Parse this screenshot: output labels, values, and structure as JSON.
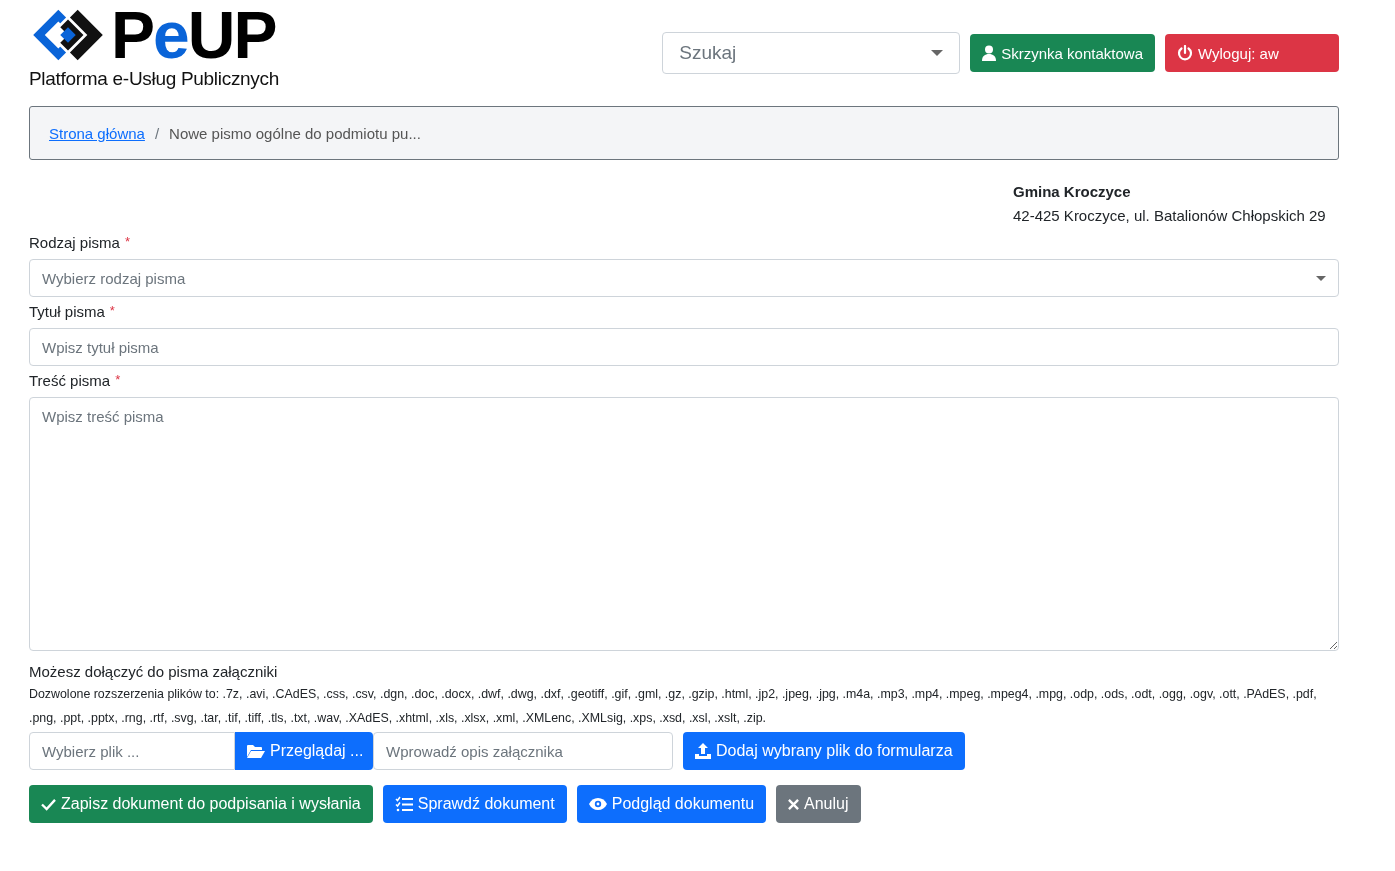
{
  "logo": {
    "parts": [
      {
        "text": "P",
        "accent": false
      },
      {
        "text": "e",
        "accent": true
      },
      {
        "text": "UP",
        "accent": false
      }
    ],
    "subtitle": "Platforma e-Usług Publicznych"
  },
  "search": {
    "placeholder": "Szukaj"
  },
  "header_buttons": [
    {
      "kind": "contact",
      "label": "Skrzynka kontaktowa"
    },
    {
      "kind": "logout",
      "label": "Wyloguj: aw"
    }
  ],
  "breadcrumb_separator": "/",
  "breadcrumb": [
    {
      "label": "Strona główna",
      "link": true
    },
    {
      "label": "Nowe pismo ogólne do podmiotu pu...",
      "link": false
    }
  ],
  "recipient": {
    "name": "Gmina Kroczyce",
    "address": "42-425 Kroczyce, ul. Batalionów Chłopskich 29"
  },
  "fields": [
    {
      "kind": "select",
      "label": "Rodzaj pisma",
      "required_mark": "*",
      "placeholder": "Wybierz rodzaj pisma"
    },
    {
      "kind": "text",
      "label": "Tytuł pisma",
      "required_mark": "*",
      "placeholder": "Wpisz tytuł pisma"
    },
    {
      "kind": "textarea",
      "label": "Treść pisma",
      "required_mark": "*",
      "placeholder": "Wpisz treść pisma"
    }
  ],
  "attachments": {
    "title": "Możesz dołączyć do pisma załączniki",
    "note": "Dozwolone rozszerzenia plików to: .7z, .avi, .CAdES, .css, .csv, .dgn, .doc, .docx, .dwf, .dwg, .dxf, .geotiff, .gif, .gml, .gz, .gzip, .html, .jp2, .jpeg, .jpg, .m4a, .mp3, .mp4, .mpeg, .mpeg4, .mpg, .odp, .ods, .odt, .ogg, .ogv, .ott, .PAdES, .pdf, .png, .ppt, .pptx, .rng, .rtf, .svg, .tar, .tif, .tiff, .tls, .txt, .wav, .XAdES, .xhtml, .xls, .xlsx, .xml, .XMLenc, .XMLsig, .xps, .xsd, .xsl, .xslt, .zip.",
    "file_placeholder": "Wybierz plik ...",
    "browse_label": "Przeglądaj ...",
    "description_placeholder": "Wprowadź opis załącznika",
    "add_label": "Dodaj wybrany plik do formularza"
  },
  "actions": [
    {
      "kind": "save",
      "label": "Zapisz dokument do podpisania i wysłania"
    },
    {
      "kind": "check",
      "label": "Sprawdź dokument"
    },
    {
      "kind": "preview",
      "label": "Podgląd dokumentu"
    },
    {
      "kind": "cancel",
      "label": "Anuluj"
    }
  ]
}
